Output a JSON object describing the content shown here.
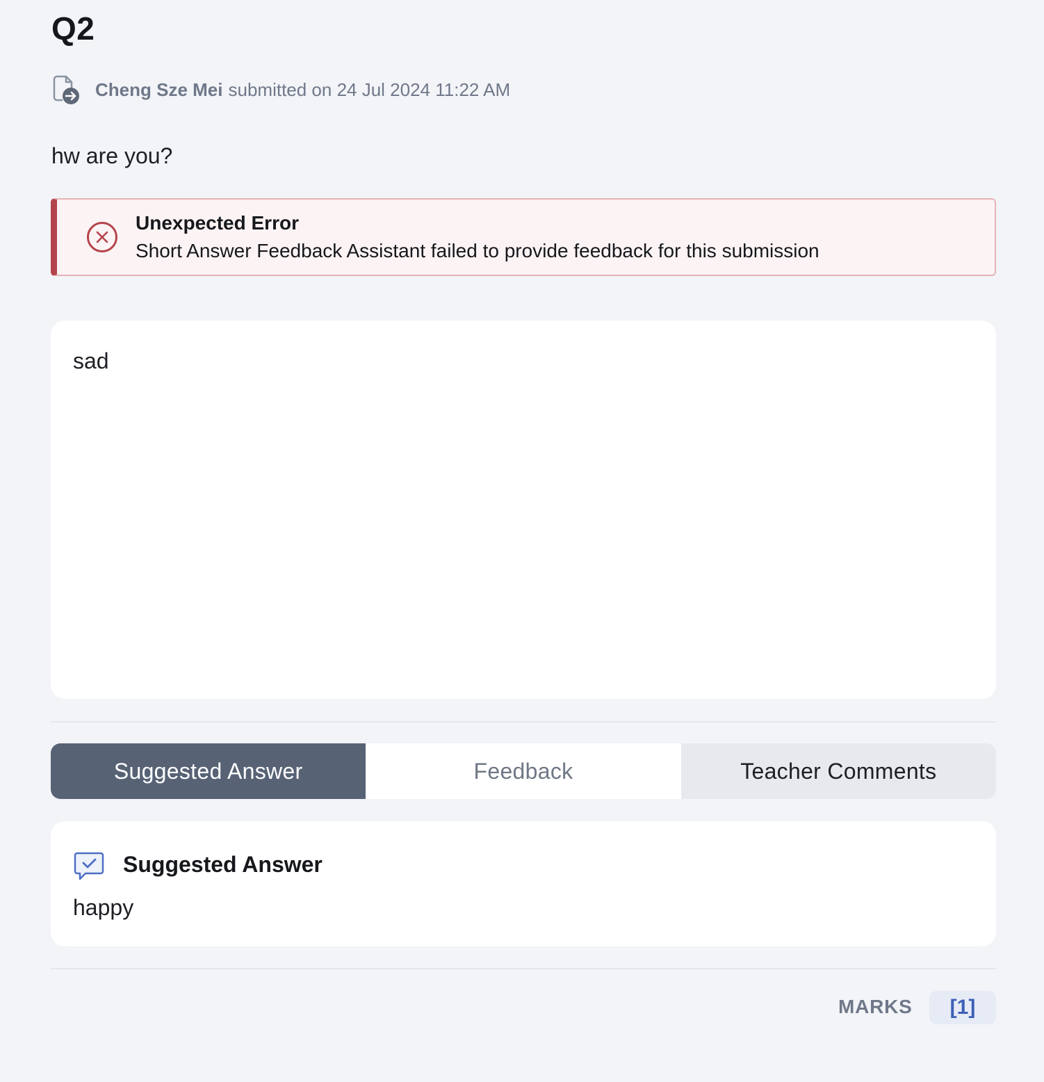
{
  "question": {
    "label": "Q2",
    "text": "hw are you?"
  },
  "submission": {
    "student_name": "Cheng Sze Mei",
    "submitted_text": "submitted on 24 Jul 2024 11:22 AM",
    "icon": "document-submit-icon"
  },
  "error": {
    "title": "Unexpected Error",
    "message": "Short Answer Feedback Assistant failed to provide feedback for this submission",
    "icon": "x-circle-icon",
    "accent_color": "#b4444b"
  },
  "answer": {
    "text": "sad"
  },
  "tabs": [
    {
      "label": "Suggested Answer",
      "active": true
    },
    {
      "label": "Feedback",
      "active": false
    },
    {
      "label": "Teacher Comments",
      "active": false
    }
  ],
  "suggested": {
    "title": "Suggested Answer",
    "text": "happy",
    "icon": "chat-check-icon"
  },
  "marks": {
    "label": "MARKS",
    "value": "[1]"
  },
  "colors": {
    "active_tab": "#576275",
    "marks_accent": "#3d5fb5"
  }
}
